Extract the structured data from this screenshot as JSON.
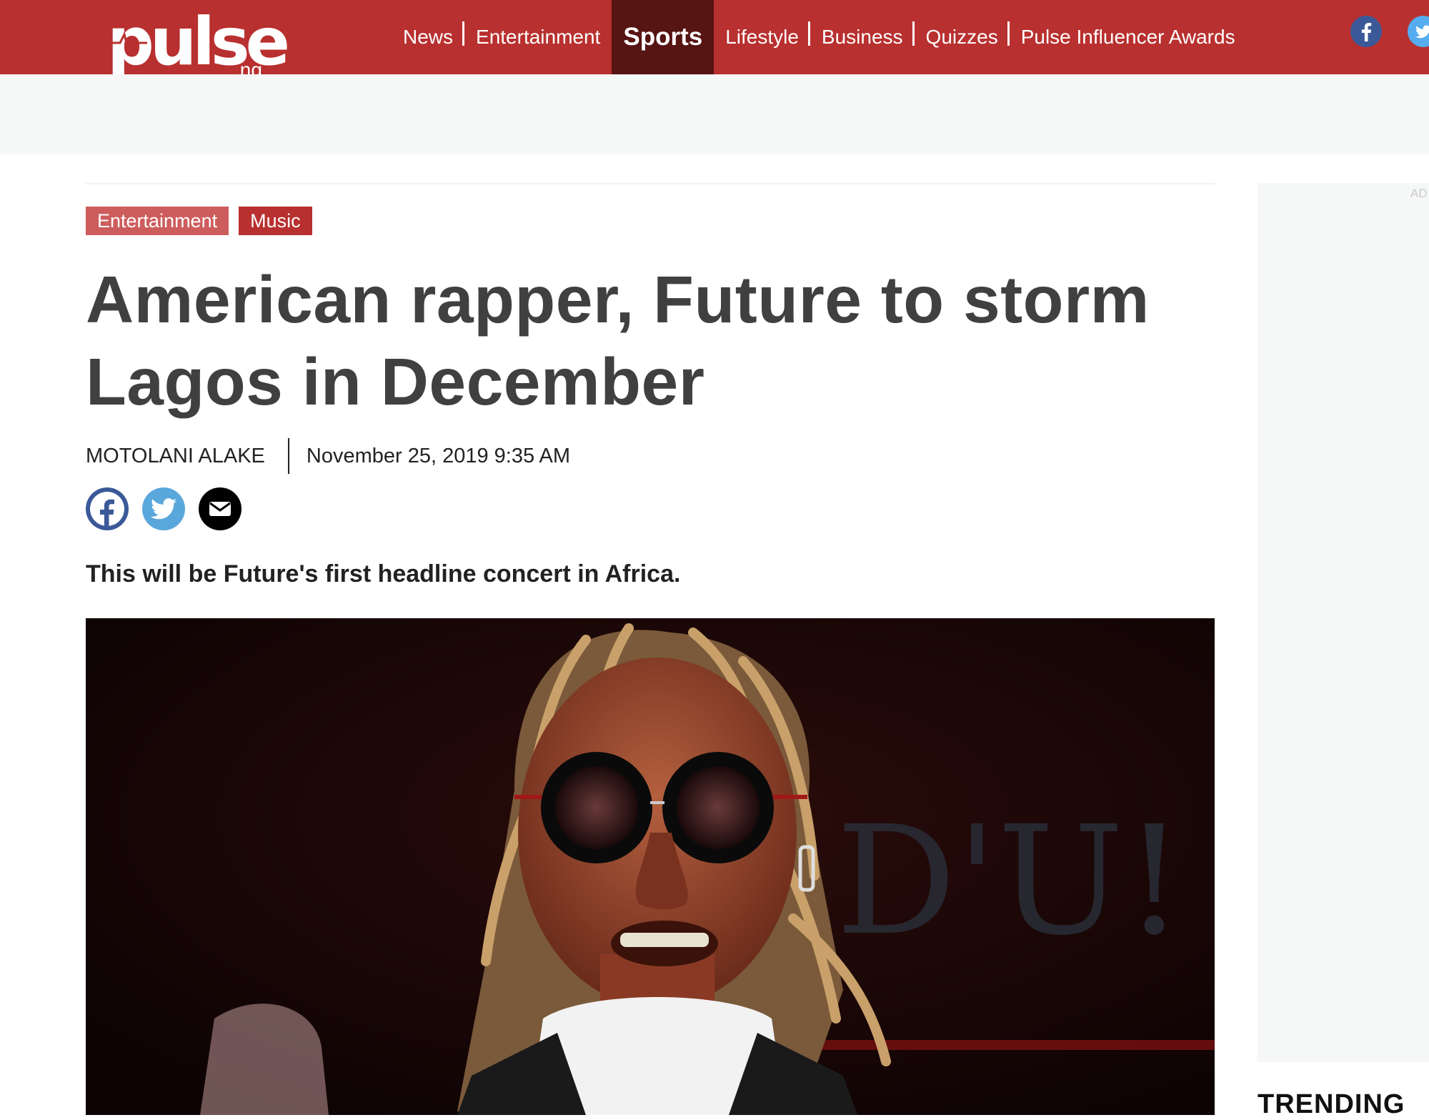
{
  "brand": {
    "name": "pulse",
    "suffix": ".ng",
    "color": "#b8302f"
  },
  "nav": {
    "items": [
      "News",
      "Entertainment",
      "Sports",
      "Lifestyle",
      "Business",
      "Quizzes",
      "Pulse Influencer Awards"
    ],
    "active": "Sports"
  },
  "header_social": [
    "facebook-icon",
    "twitter-icon"
  ],
  "article": {
    "tags": [
      "Entertainment",
      "Music"
    ],
    "headline_line1": "American rapper, Future to storm",
    "headline_line2": "Lagos in December",
    "author": "MOTOLANI ALAKE",
    "date": "November 25, 2019 9:35 AM",
    "share": [
      "facebook-icon",
      "twitter-icon",
      "email-icon"
    ],
    "lead": "This will be Future's first headline concert in Africa.",
    "image_overlay_text": "D'U!"
  },
  "sidebar": {
    "ad_label": "AD",
    "section_title": "TRENDING"
  },
  "colors": {
    "nav_bg": "#b8302f",
    "active_nav_bg": "#561412",
    "tag_entertainment": "#cd5d5c",
    "tag_music": "#b8302f",
    "headline": "#404040"
  }
}
